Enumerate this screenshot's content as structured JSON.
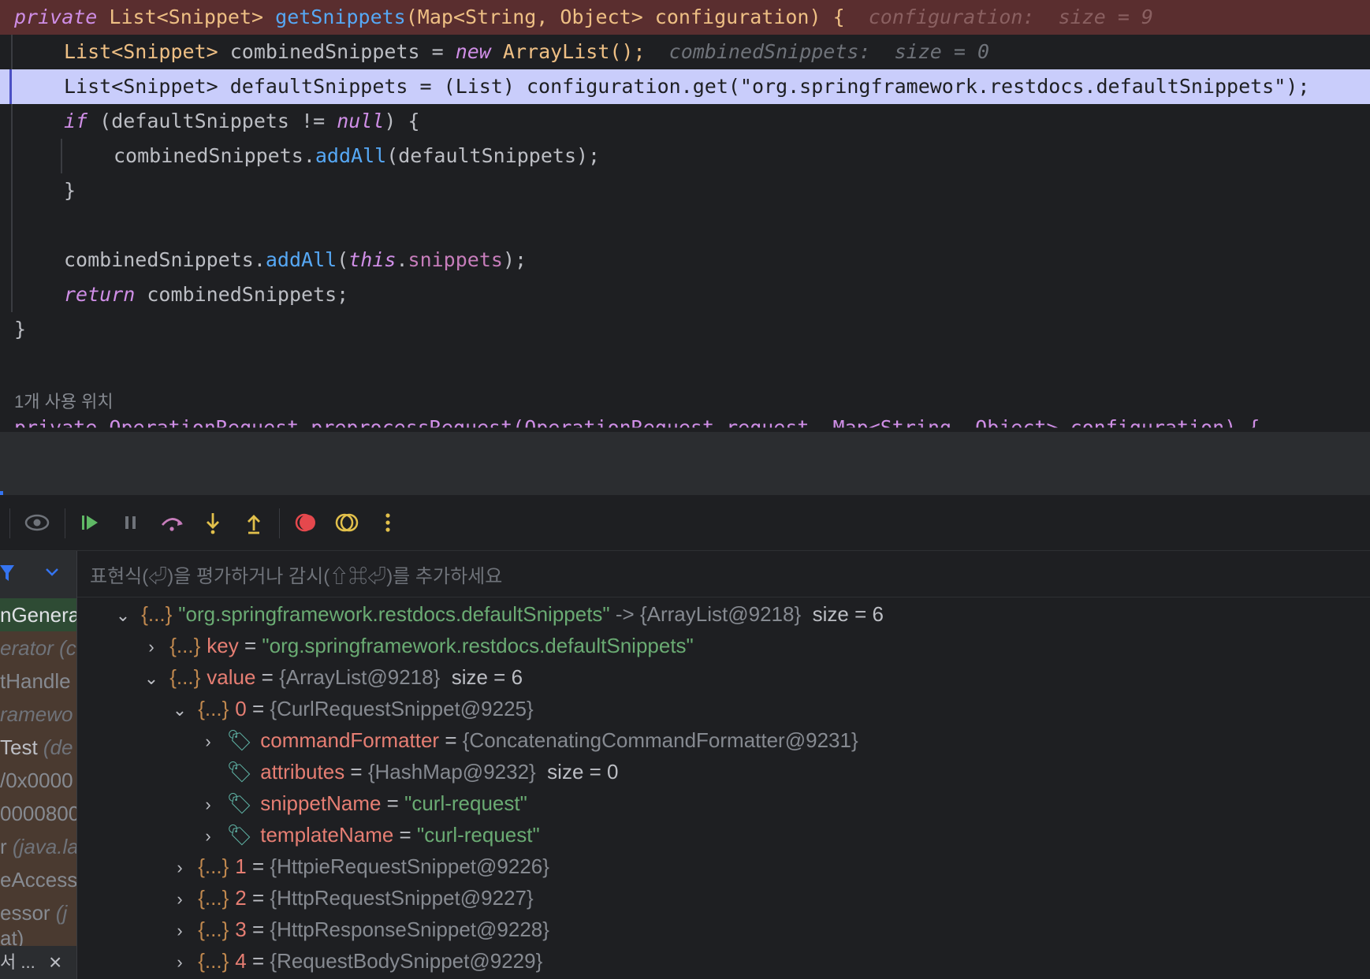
{
  "editor": {
    "line1": {
      "private": "private",
      "rettype": "List<Snippet>",
      "method": "getSnippets",
      "params": "(Map<String, Object> configuration) {",
      "hint": "configuration:  size = 9"
    },
    "line2": {
      "type": "List<Snippet>",
      "rest": " combinedSnippets = ",
      "new": "new",
      "ctor": " ArrayList();",
      "hint": "combinedSnippets:  size = 0"
    },
    "line3": {
      "text": "List<Snippet> defaultSnippets = (List) configuration.get(\"org.springframework.restdocs.defaultSnippets\");"
    },
    "line4": {
      "if": "if",
      "cond": " (defaultSnippets != ",
      "null": "null",
      "tail": ") {"
    },
    "line5": {
      "obj": "combinedSnippets.",
      "method": "addAll",
      "args": "(defaultSnippets);"
    },
    "line6": {
      "text": "}"
    },
    "line8": {
      "obj": "combinedSnippets.",
      "method": "addAll",
      "open": "(",
      "this": "this",
      "dot": ".",
      "field": "snippets",
      "close": ");"
    },
    "line9": {
      "return": "return",
      "rest": " combinedSnippets;"
    },
    "line10": {
      "text": "}"
    },
    "usage_hint": "1개 사용 위치",
    "peek_line": "private OperationRequest preprocessRequest(OperationRequest request, Map<String, Object> configuration) {"
  },
  "toolbar": {
    "icons": [
      "eye-icon",
      "resume-icon",
      "pause-icon",
      "step-over-icon",
      "step-into-icon",
      "step-out-icon",
      "breakpoints-icon",
      "mute-breakpoints-icon",
      "more-icon"
    ],
    "colors": {
      "resume": "#5fb865",
      "stepping": "#e2c04b",
      "breakpoint": "#e5484d",
      "stepover": "#c77dbb"
    }
  },
  "frames": {
    "items": [
      {
        "cls": "nGenera",
        "pkg": ""
      },
      {
        "cls": "erator",
        "pkg": " (c"
      },
      {
        "cls": "tHandle",
        "pkg": ""
      },
      {
        "cls": "ramewo",
        "pkg": ""
      },
      {
        "cls": "Test",
        "pkg": " (de"
      },
      {
        "cls": "/0x0000",
        "pkg": ""
      },
      {
        "cls": "0000800",
        "pkg": ""
      },
      {
        "cls": "r",
        "pkg": " (java.la"
      },
      {
        "cls": "eAccess",
        "pkg": ""
      },
      {
        "cls": "essor",
        "pkg": " (j"
      },
      {
        "cls": "at)",
        "pkg": ""
      }
    ],
    "bottom_label": "서 ...",
    "close": "×"
  },
  "variables": {
    "eval_placeholder": "표현식(⏎)을 평가하거나 감시(⇧⌘⏎)를 추가하세요",
    "root": {
      "name": "\"org.springframework.restdocs.defaultSnippets\"",
      "arrow": " -> ",
      "ref": "{ArrayList@9218}",
      "size": "size = 6"
    },
    "key": {
      "name": "key",
      "eq": " = ",
      "value": "\"org.springframework.restdocs.defaultSnippets\""
    },
    "value": {
      "name": "value",
      "eq": " = ",
      "ref": "{ArrayList@9218}",
      "size": "size = 6"
    },
    "item0": {
      "name": "0",
      "eq": " = ",
      "ref": "{CurlRequestSnippet@9225}"
    },
    "cmd": {
      "name": "commandFormatter",
      "eq": " = ",
      "ref": "{ConcatenatingCommandFormatter@9231}"
    },
    "attrs": {
      "name": "attributes",
      "eq": " = ",
      "ref": "{HashMap@9232}",
      "size": "size = 0"
    },
    "snip": {
      "name": "snippetName",
      "eq": " = ",
      "value": "\"curl-request\""
    },
    "tmpl": {
      "name": "templateName",
      "eq": " = ",
      "value": "\"curl-request\""
    },
    "item1": {
      "name": "1",
      "eq": " = ",
      "ref": "{HttpieRequestSnippet@9226}"
    },
    "item2": {
      "name": "2",
      "eq": " = ",
      "ref": "{HttpRequestSnippet@9227}"
    },
    "item3": {
      "name": "3",
      "eq": " = ",
      "ref": "{HttpResponseSnippet@9228}"
    },
    "item4": {
      "name": "4",
      "eq": " = ",
      "ref": "{RequestBodySnippet@9229}"
    },
    "obj_glyph": "{...}",
    "field_glyph": "🏷"
  }
}
